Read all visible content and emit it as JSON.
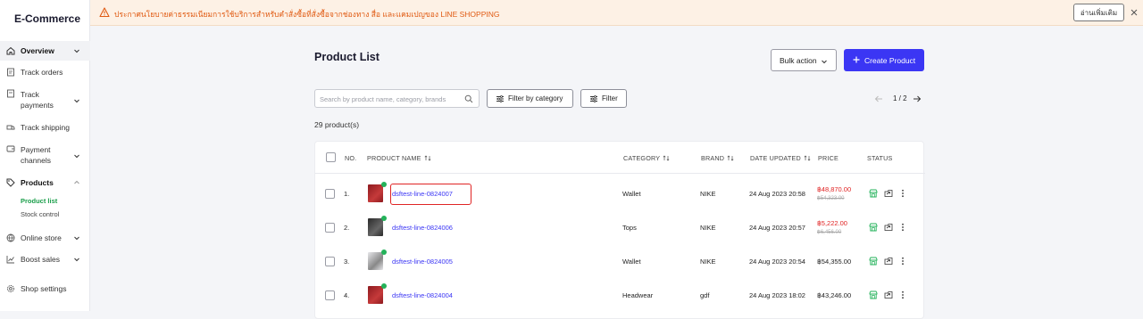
{
  "sidebar": {
    "brand": "E-Commerce",
    "items": [
      {
        "label": "Overview",
        "icon": "home-icon",
        "chevron": "down"
      },
      {
        "label": "Track orders",
        "icon": "orders-icon"
      },
      {
        "label": "Track\npayments",
        "icon": "payments-icon",
        "chevron": "down"
      },
      {
        "label": "Track shipping",
        "icon": "shipping-icon"
      },
      {
        "label": "Payment\nchannels",
        "icon": "wallet-icon",
        "chevron": "down"
      },
      {
        "label": "Products",
        "icon": "tag-icon",
        "chevron": "up"
      },
      {
        "label": "Online store",
        "icon": "globe-icon",
        "chevron": "down"
      },
      {
        "label": "Boost sales",
        "icon": "chart-icon",
        "chevron": "down"
      },
      {
        "label": "Shop settings",
        "icon": "gear-icon"
      }
    ],
    "sub_items": [
      "Product list",
      "Stock control"
    ]
  },
  "banner": {
    "message": "ประกาศนโยบายค่าธรรมเนียมการใช้บริการสำหรับคำสั่งซื้อที่สั่งซื้อจากช่องทาง สื่อ และแคมเปญของ LINE SHOPPING",
    "more_label": "อ่านเพิ่มเติม",
    "color": "#e05a12"
  },
  "page": {
    "title": "Product List",
    "bulk_label": "Bulk action",
    "create_label": "Create Product",
    "search_placeholder": "Search by product name, category, brands",
    "filter_category_label": "Filter by category",
    "filter_label": "Filter",
    "pagination": "1 / 2",
    "count": "29 product(s)"
  },
  "table": {
    "headers": {
      "no": "NO.",
      "name": "PRODUCT NAME",
      "category": "CATEGORY",
      "brand": "BRAND",
      "date": "DATE UPDATED",
      "price": "PRICE",
      "status": "STATUS"
    },
    "rows": [
      {
        "no": "1.",
        "name": "dsftest-line-0824007",
        "category": "Wallet",
        "brand": "NIKE",
        "date": "24 Aug 2023 20:58",
        "price": "฿48,870.00",
        "original": "฿54,323.00",
        "sale": true,
        "thumb": "red"
      },
      {
        "no": "2.",
        "name": "dsftest-line-0824006",
        "category": "Tops",
        "brand": "NIKE",
        "date": "24 Aug 2023 20:57",
        "price": "฿5,222.00",
        "original": "฿6,456.00",
        "sale": true,
        "thumb": "dark"
      },
      {
        "no": "3.",
        "name": "dsftest-line-0824005",
        "category": "Wallet",
        "brand": "NIKE",
        "date": "24 Aug 2023 20:54",
        "price": "฿54,355.00",
        "original": "",
        "sale": false,
        "thumb": "light"
      },
      {
        "no": "4.",
        "name": "dsftest-line-0824004",
        "category": "Headwear",
        "brand": "gdf",
        "date": "24 Aug 2023 18:02",
        "price": "฿43,246.00",
        "original": "",
        "sale": false,
        "thumb": "red"
      }
    ]
  },
  "colors": {
    "accent": "#3b36f4",
    "status_green": "#23b25a",
    "sale_red": "#e02424"
  }
}
